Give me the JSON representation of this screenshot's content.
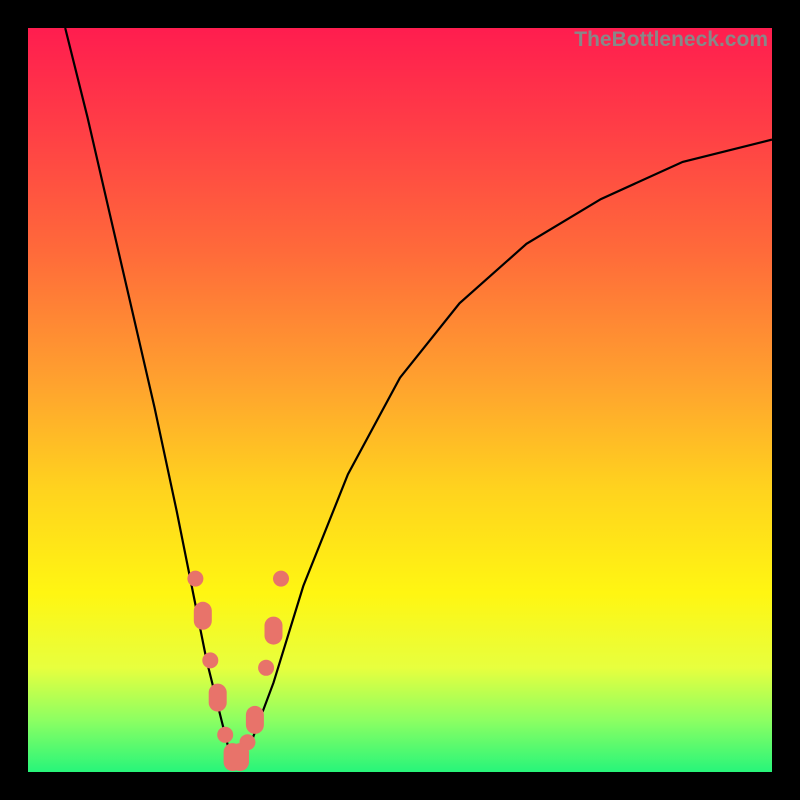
{
  "watermark": "TheBottleneck.com",
  "chart_data": {
    "type": "line",
    "title": "",
    "xlabel": "",
    "ylabel": "",
    "xlim": [
      0,
      100
    ],
    "ylim": [
      0,
      100
    ],
    "grid": false,
    "series": [
      {
        "name": "bottleneck-curve-left",
        "x": [
          5,
          8,
          11,
          14,
          17,
          20,
          22,
          24,
          26,
          27,
          28
        ],
        "values": [
          100,
          88,
          75,
          62,
          49,
          35,
          25,
          15,
          7,
          3,
          1
        ]
      },
      {
        "name": "bottleneck-curve-right",
        "x": [
          28,
          30,
          33,
          37,
          43,
          50,
          58,
          67,
          77,
          88,
          100
        ],
        "values": [
          1,
          4,
          12,
          25,
          40,
          53,
          63,
          71,
          77,
          82,
          85
        ]
      }
    ],
    "markers": {
      "name": "nodes",
      "x": [
        22.5,
        23.5,
        24.5,
        25.5,
        26.5,
        27.5,
        28.5,
        29.5,
        30.5,
        32.0,
        33.0,
        34.0
      ],
      "values": [
        26,
        21,
        15,
        10,
        5,
        2,
        2,
        4,
        7,
        14,
        19,
        26
      ],
      "heavy_pairs": [
        [
          23.5,
          21
        ],
        [
          25.5,
          10
        ],
        [
          27.5,
          2
        ],
        [
          28.5,
          2
        ],
        [
          30.5,
          7
        ],
        [
          33.0,
          19
        ]
      ]
    },
    "colors": {
      "curve": "#000000",
      "marker": "#e8736a",
      "top": "#ff1d4f",
      "bottom": "#27f57a"
    }
  }
}
